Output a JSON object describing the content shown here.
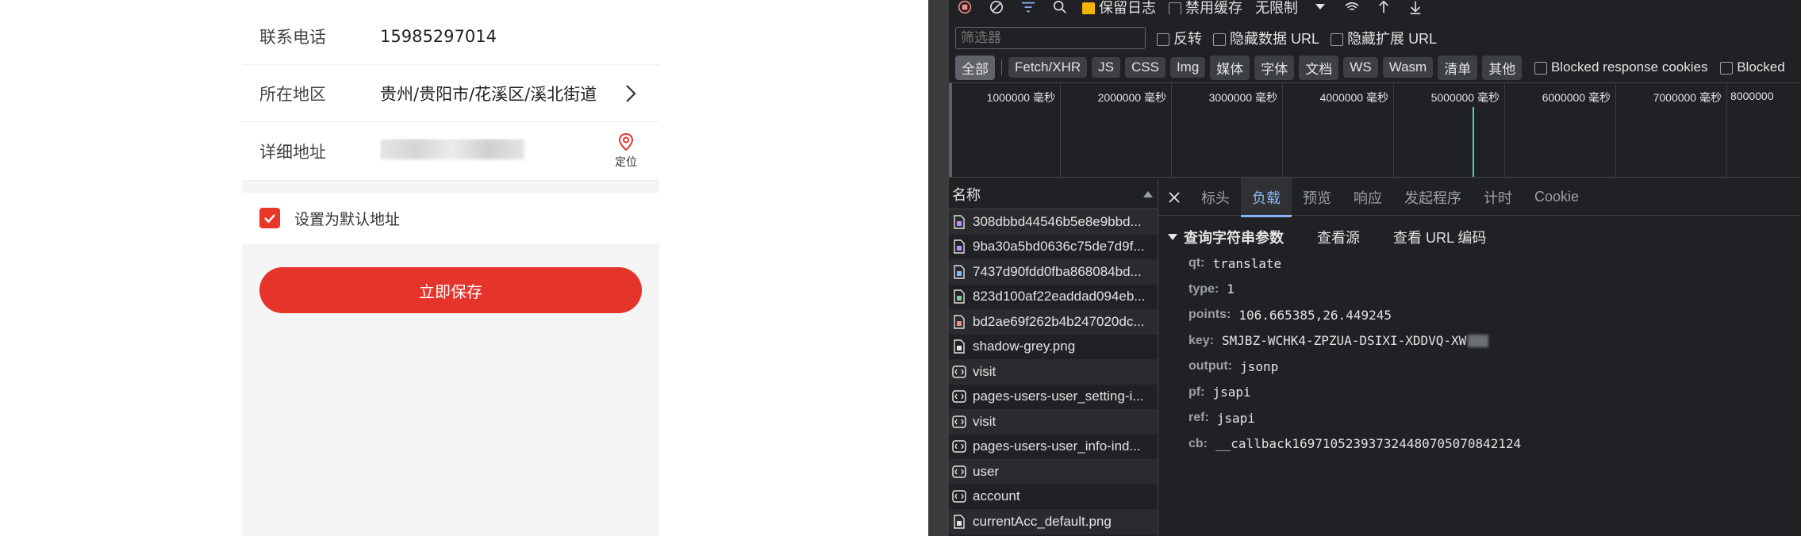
{
  "app": {
    "phone_label": "联系电话",
    "phone_value": "15985297014",
    "region_label": "所在地区",
    "region_value": "贵州/贵阳市/花溪区/溪北街道",
    "address_label": "详细地址",
    "locate_label": "定位",
    "default_label": "设置为默认地址",
    "save_label": "立即保存"
  },
  "devtools": {
    "toolbar": {
      "preserve_log": "保留日志",
      "disable_cache": "禁用缓存",
      "throttle": "无限制"
    },
    "filter": {
      "placeholder": "筛选器",
      "invert": "反转",
      "hide_data_urls": "隐藏数据 URL",
      "hide_ext_urls": "隐藏扩展 URL"
    },
    "types": [
      "全部",
      "Fetch/XHR",
      "JS",
      "CSS",
      "Img",
      "媒体",
      "字体",
      "文档",
      "WS",
      "Wasm",
      "清单",
      "其他"
    ],
    "blocked_cookies": "Blocked response cookies",
    "blocked_short": "Blocked",
    "timeline_ticks": [
      "1000000 毫秒",
      "2000000 毫秒",
      "3000000 毫秒",
      "4000000 毫秒",
      "5000000 毫秒",
      "6000000 毫秒",
      "7000000 毫秒",
      "8000000"
    ],
    "name_header": "名称",
    "requests": [
      {
        "name": "308dbbd44546b5e8e9bbd...",
        "icon": "image-file-icon",
        "color": "#c58af9"
      },
      {
        "name": "9ba30a5bd0636c75de7d9f...",
        "icon": "image-file-icon",
        "color": "#c58af9"
      },
      {
        "name": "7437d90fdd0fba868084bd...",
        "icon": "image-file-icon",
        "color": "#8ab4f8"
      },
      {
        "name": "823d100af22eaddad094eb...",
        "icon": "image-file-icon",
        "color": "#81c995"
      },
      {
        "name": "bd2ae69f262b4b247020dc...",
        "icon": "image-file-icon",
        "color": "#f28b82"
      },
      {
        "name": "shadow-grey.png",
        "icon": "file-icon",
        "color": "#e3e3e3"
      },
      {
        "name": "visit",
        "icon": "xhr-icon",
        "color": "#e3e3e3"
      },
      {
        "name": "pages-users-user_setting-i...",
        "icon": "xhr-icon",
        "color": "#e3e3e3"
      },
      {
        "name": "visit",
        "icon": "xhr-icon",
        "color": "#e3e3e3"
      },
      {
        "name": "pages-users-user_info-ind...",
        "icon": "xhr-icon",
        "color": "#e3e3e3"
      },
      {
        "name": "user",
        "icon": "xhr-icon",
        "color": "#e3e3e3"
      },
      {
        "name": "account",
        "icon": "xhr-icon",
        "color": "#e3e3e3"
      },
      {
        "name": "currentAcc_default.png",
        "icon": "file-icon",
        "color": "#e3e3e3"
      }
    ],
    "tabs": [
      "标头",
      "负载",
      "预览",
      "响应",
      "发起程序",
      "计时",
      "Cookie"
    ],
    "section_title": "查询字符串参数",
    "view_source": "查看源",
    "view_url_encoded": "查看 URL 编码",
    "params": [
      {
        "k": "qt:",
        "v": "translate"
      },
      {
        "k": "type:",
        "v": "1"
      },
      {
        "k": "points:",
        "v": "106.665385,26.449245"
      },
      {
        "k": "key:",
        "v": "SMJBZ-WCHK4-ZPZUA-DSIXI-XDDVQ-XW"
      },
      {
        "k": "output:",
        "v": "jsonp"
      },
      {
        "k": "pf:",
        "v": "jsapi"
      },
      {
        "k": "ref:",
        "v": "jsapi"
      },
      {
        "k": "cb:",
        "v": "__callback169710523937324480705070842124"
      }
    ]
  }
}
